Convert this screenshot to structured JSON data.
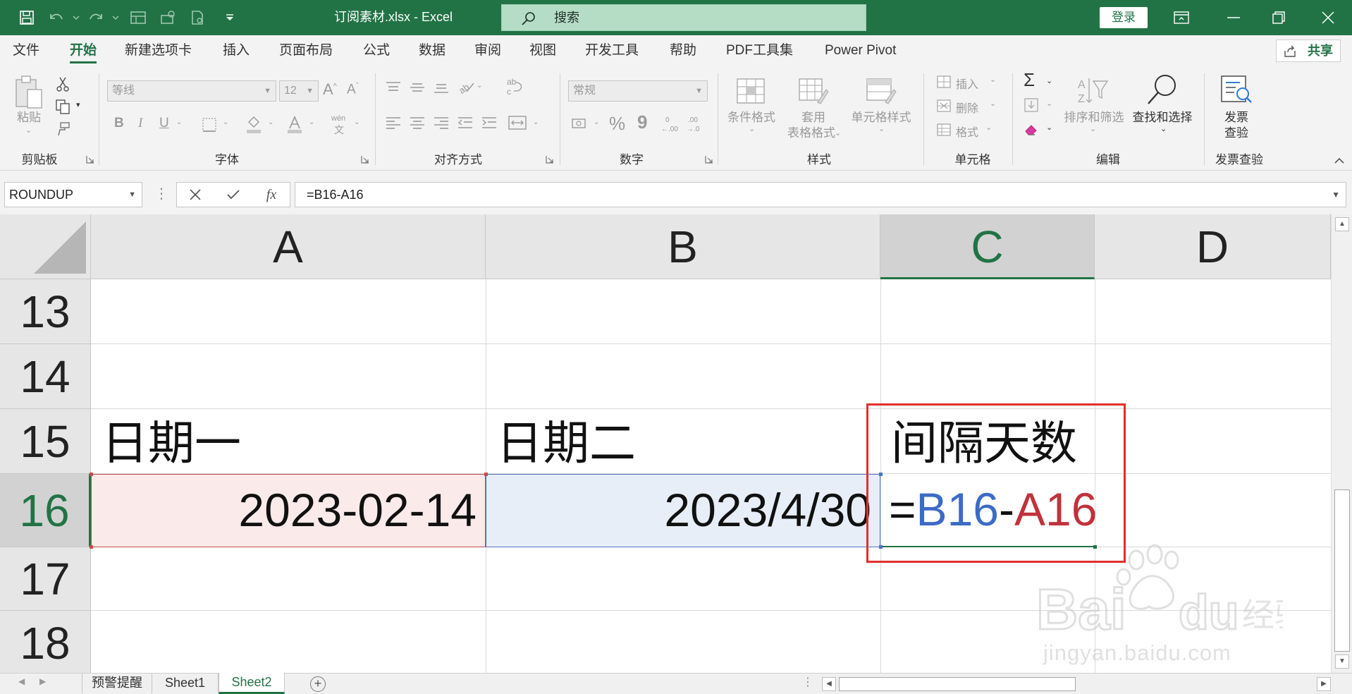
{
  "colors": {
    "excel_green": "#217346",
    "ref_a": "#c0323c",
    "ref_b": "#3c6bc6",
    "highlight": "#e0302d"
  },
  "titlebar": {
    "title": "订阅素材.xlsx  -  Excel",
    "search_placeholder": "搜索",
    "login_label": "登录",
    "icons": [
      "save-icon",
      "undo-icon",
      "redo-icon",
      "form-icon",
      "share-icon",
      "print-icon",
      "customize-icon",
      "ribbon-display-icon",
      "minimize-icon",
      "restore-icon",
      "close-icon"
    ]
  },
  "menu": {
    "tabs": [
      "文件",
      "开始",
      "新建选项卡",
      "插入",
      "页面布局",
      "公式",
      "数据",
      "审阅",
      "视图",
      "开发工具",
      "帮助",
      "PDF工具集",
      "Power Pivot"
    ],
    "active": "开始",
    "share_label": "共享"
  },
  "ribbon": {
    "clipboard": {
      "label": "剪贴板",
      "paste": "粘贴"
    },
    "font": {
      "label": "字体",
      "font_name": "等线",
      "font_size": "12",
      "bold": "B",
      "italic": "I",
      "underline": "U",
      "wen": "wén",
      "wen2": "文"
    },
    "alignment": {
      "label": "对齐方式"
    },
    "number": {
      "label": "数字",
      "format": "常规",
      "percent": "%",
      "comma": "9"
    },
    "styles": {
      "label": "样式",
      "conditional": "条件格式",
      "table_format_1": "套用",
      "table_format_2": "表格格式",
      "cell_styles": "单元格样式"
    },
    "cells": {
      "label": "单元格",
      "insert": "插入",
      "delete": "删除",
      "format": "格式"
    },
    "editing": {
      "label": "编辑",
      "sort_filter": "排序和筛选",
      "find_select": "查找和选择"
    },
    "invoice": {
      "label": "发票查验",
      "btn_1": "发票",
      "btn_2": "查验"
    }
  },
  "formula_bar": {
    "name_box": "ROUNDUP",
    "formula": "=B16-A16",
    "fx": "fx"
  },
  "sheet": {
    "columns": [
      "A",
      "B",
      "C",
      "D"
    ],
    "selected_column": "C",
    "rows": [
      "13",
      "14",
      "15",
      "16",
      "17",
      "18"
    ],
    "selected_row": "16",
    "cells": {
      "A15": "日期一",
      "B15": "日期二",
      "C15": "间隔天数",
      "A16": "2023-02-14",
      "B16": "2023/4/30",
      "C16_eq": "=",
      "C16_ref_b": "B16",
      "C16_minus": "-",
      "C16_ref_a": "A16"
    }
  },
  "sheet_tabs": {
    "tabs": [
      "预警提醒",
      "Sheet1",
      "Sheet2"
    ],
    "active": "Sheet2"
  },
  "watermark": {
    "brand": "Bai du 经验",
    "url": "jingyan.baidu.com"
  }
}
